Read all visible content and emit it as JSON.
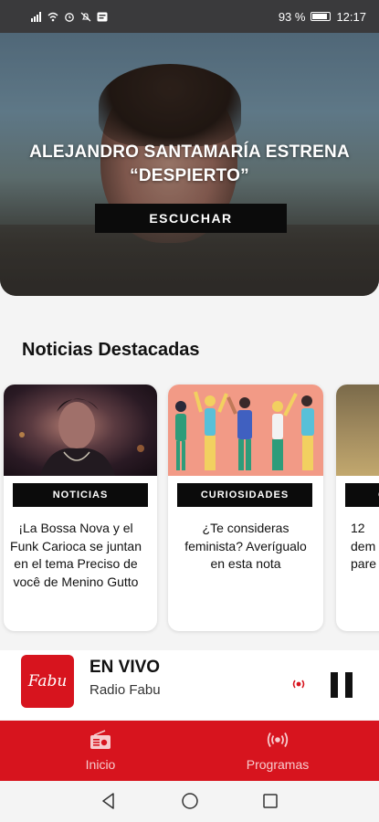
{
  "status_bar": {
    "battery": "93 %",
    "time": "12:17"
  },
  "hero": {
    "title_line1": "ALEJANDRO SANTAMARÍA ESTRENA",
    "title_line2": "“DESPIERTO”",
    "button_label": "ESCUCHAR"
  },
  "featured": {
    "title": "Noticias Destacadas",
    "cards": [
      {
        "tag": "NOTICIAS",
        "lines": [
          "¡La Bossa Nova y el",
          "Funk Carioca se juntan",
          "en el tema Preciso de",
          "você de Menino Gutto"
        ]
      },
      {
        "tag": "CURIOSIDADES",
        "lines": [
          "¿Te consideras",
          "feminista? Averígualo",
          "en esta nota"
        ]
      },
      {
        "tag": "C",
        "lines": [
          "12",
          "dem",
          "pare"
        ]
      }
    ]
  },
  "player": {
    "logo_text": "Fabu",
    "status": "EN VIVO",
    "station": "Radio Fabu",
    "live_icon": "broadcast-icon",
    "action_icon": "pause-icon"
  },
  "bottom_nav": {
    "items": [
      {
        "label": "Inicio",
        "icon": "radio-icon"
      },
      {
        "label": "Programas",
        "icon": "broadcast-icon"
      }
    ]
  },
  "colors": {
    "brand_red": "#d7141e",
    "tag_background": "#0b0b0b",
    "status_bar": "#3a3a3c"
  }
}
